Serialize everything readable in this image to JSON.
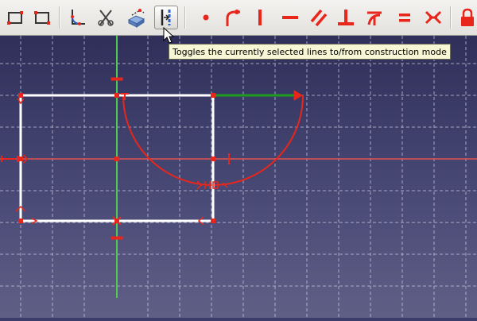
{
  "toolbar": {
    "buttons": [
      {
        "name": "sketch-rectangle-button",
        "icon": "rectangle-icon"
      },
      {
        "name": "sketch-polyline-button",
        "icon": "polyline-icon"
      },
      {
        "name": "sketch-fillet-button",
        "icon": "fillet-icon"
      },
      {
        "name": "sketch-trim-button",
        "icon": "trim-icon"
      },
      {
        "name": "sketch-external-geometry-button",
        "icon": "external-geometry-icon"
      },
      {
        "name": "toggle-construction-button",
        "icon": "construction-toggle-icon",
        "active": true
      },
      {
        "name": "constrain-coincident-button",
        "icon": "coincident-point-icon"
      },
      {
        "name": "constrain-point-on-object-button",
        "icon": "point-on-object-icon"
      },
      {
        "name": "constrain-vertical-button",
        "icon": "vertical-constraint-icon"
      },
      {
        "name": "constrain-horizontal-button",
        "icon": "horizontal-constraint-icon"
      },
      {
        "name": "constrain-parallel-button",
        "icon": "parallel-constraint-icon"
      },
      {
        "name": "constrain-perpendicular-button",
        "icon": "perpendicular-constraint-icon"
      },
      {
        "name": "constrain-tangent-button",
        "icon": "tangent-constraint-icon"
      },
      {
        "name": "constrain-equal-button",
        "icon": "equal-constraint-icon"
      },
      {
        "name": "constrain-symmetric-button",
        "icon": "symmetric-constraint-icon"
      },
      {
        "name": "constrain-lock-button",
        "icon": "lock-icon"
      }
    ]
  },
  "tooltip": {
    "text": "Toggles the currently selected lines to/from construction mode"
  },
  "sketch": {
    "line_color": "#ffffff",
    "constraint_color": "#e8261b",
    "vertical_axis_color": "#4fc94f",
    "selected_line_color": "#1f9b1f",
    "horizontal_axis_color": "#e05050",
    "grid_color": "#c8c8dc"
  }
}
